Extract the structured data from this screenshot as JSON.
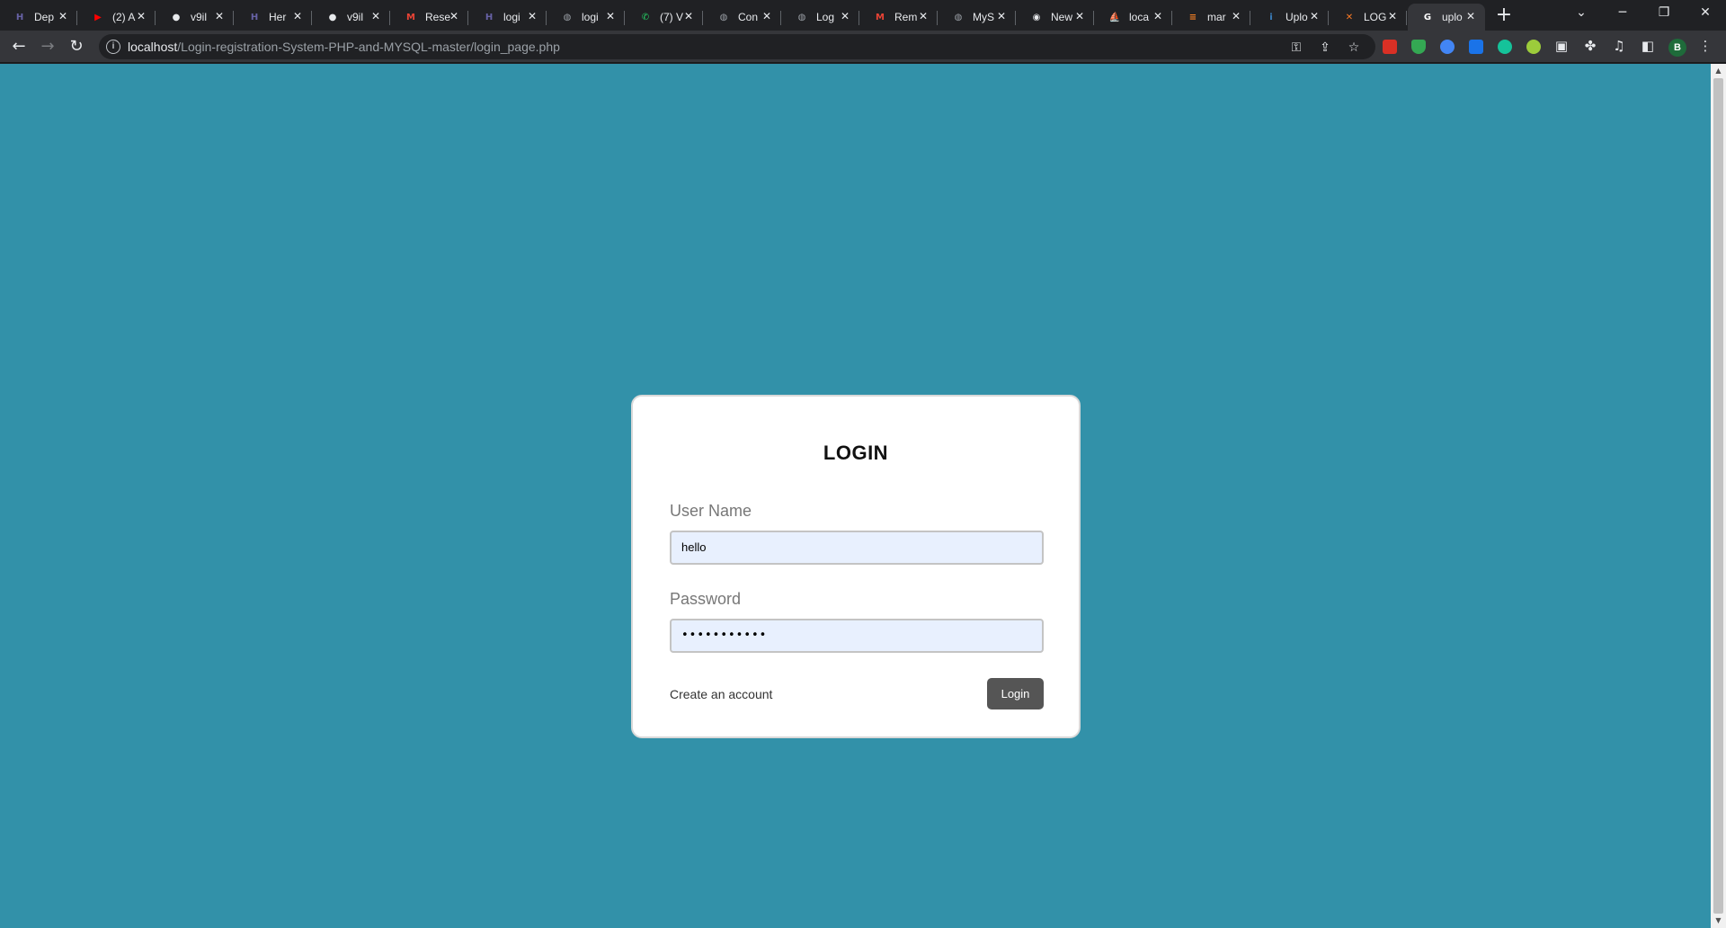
{
  "browser": {
    "tabs": [
      {
        "label": "Dep",
        "icon": "heroku-icon",
        "icon_color": "#6762a6",
        "glyph": "H"
      },
      {
        "label": "(2) A",
        "icon": "youtube-icon",
        "icon_color": "#ff0000",
        "glyph": "▶"
      },
      {
        "label": "v9il",
        "icon": "github-icon",
        "icon_color": "#e8eaed",
        "glyph": "●"
      },
      {
        "label": "Her",
        "icon": "heroku-icon",
        "icon_color": "#6762a6",
        "glyph": "H"
      },
      {
        "label": "v9il",
        "icon": "github-icon",
        "icon_color": "#e8eaed",
        "glyph": "●"
      },
      {
        "label": "Rese",
        "icon": "gmail-icon",
        "icon_color": "#ea4335",
        "glyph": "M"
      },
      {
        "label": "logi",
        "icon": "heroku-icon",
        "icon_color": "#6762a6",
        "glyph": "H"
      },
      {
        "label": "logi",
        "icon": "globe-icon",
        "icon_color": "#9aa0a6",
        "glyph": "◍"
      },
      {
        "label": "(7) V",
        "icon": "whatsapp-icon",
        "icon_color": "#25d366",
        "glyph": "✆"
      },
      {
        "label": "Con",
        "icon": "globe-icon",
        "icon_color": "#9aa0a6",
        "glyph": "◍"
      },
      {
        "label": "Log",
        "icon": "globe-icon",
        "icon_color": "#9aa0a6",
        "glyph": "◍"
      },
      {
        "label": "Rem",
        "icon": "gmail-icon",
        "icon_color": "#ea4335",
        "glyph": "M"
      },
      {
        "label": "MyS",
        "icon": "globe-icon",
        "icon_color": "#9aa0a6",
        "glyph": "◍"
      },
      {
        "label": "New",
        "icon": "chrome-icon",
        "icon_color": "#e8eaed",
        "glyph": "◉"
      },
      {
        "label": "loca",
        "icon": "phpmyadmin-icon",
        "icon_color": "#f89c0e",
        "glyph": "⛵"
      },
      {
        "label": "mar",
        "icon": "stackoverflow-icon",
        "icon_color": "#f48024",
        "glyph": "≡"
      },
      {
        "label": "Uplo",
        "icon": "imgbb-icon",
        "icon_color": "#3b82c4",
        "glyph": "i"
      },
      {
        "label": "LOG",
        "icon": "xampp-icon",
        "icon_color": "#fb7a24",
        "glyph": "✕"
      },
      {
        "label": "uplo",
        "icon": "google-icon",
        "icon_color": "#ffffff",
        "glyph": "G",
        "active": true
      }
    ],
    "new_tab_glyph": "+",
    "address": {
      "host": "localhost",
      "path": "/Login-registration-System-PHP-and-MYSQL-master/login_page.php"
    }
  },
  "page": {
    "background_color": "#3291a9",
    "login": {
      "title": "LOGIN",
      "username_label": "User Name",
      "username_value": "hello",
      "password_label": "Password",
      "password_masked": "•••••••••••",
      "create_account_link": "Create an account",
      "login_button": "Login"
    }
  }
}
